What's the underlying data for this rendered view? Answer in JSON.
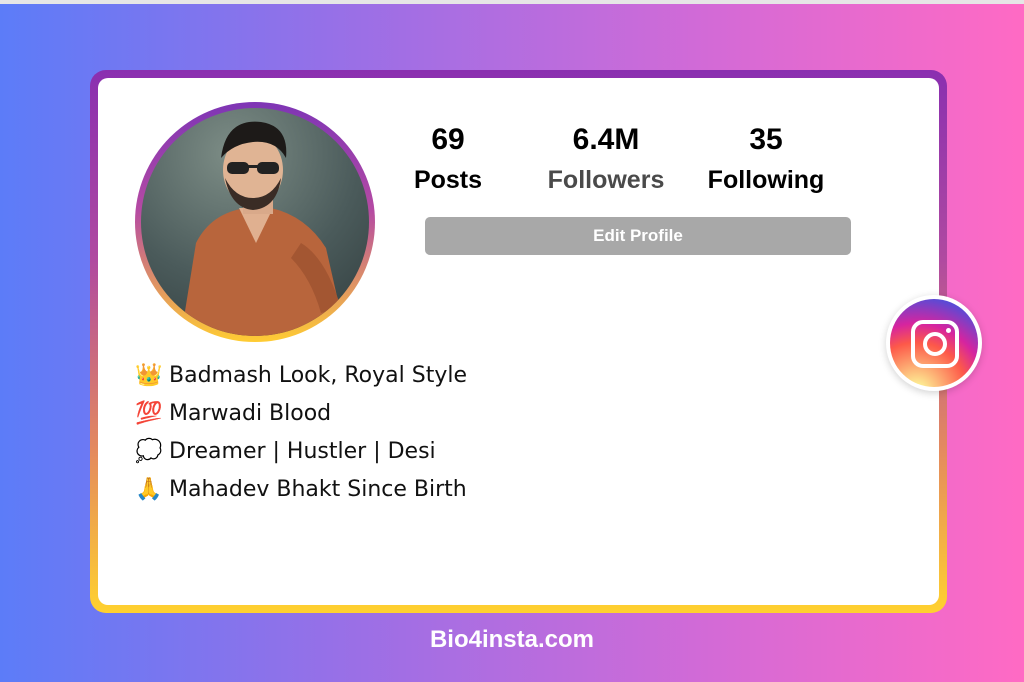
{
  "profile": {
    "stats": [
      {
        "value": "69",
        "label": "Posts"
      },
      {
        "value": "6.4M",
        "label": "Followers"
      },
      {
        "value": "35",
        "label": "Following"
      }
    ],
    "edit_button": "Edit Profile"
  },
  "bio": [
    {
      "emoji": "👑",
      "text": "Badmash Look, Royal Style"
    },
    {
      "emoji": "💯",
      "text": "Marwadi Blood"
    },
    {
      "emoji": "💭",
      "text": "Dreamer | Hustler | Desi"
    },
    {
      "emoji": "🙏",
      "text": "Mahadev Bhakt Since Birth"
    }
  ],
  "footer": {
    "site": "Bio4insta.com"
  },
  "icons": {
    "avatar": "profile-photo",
    "brand": "instagram-icon"
  },
  "colors": {
    "background_start": "#5c7cf8",
    "background_end": "#ff6ac4",
    "button": "#a8a8a8",
    "card": "#ffffff"
  }
}
